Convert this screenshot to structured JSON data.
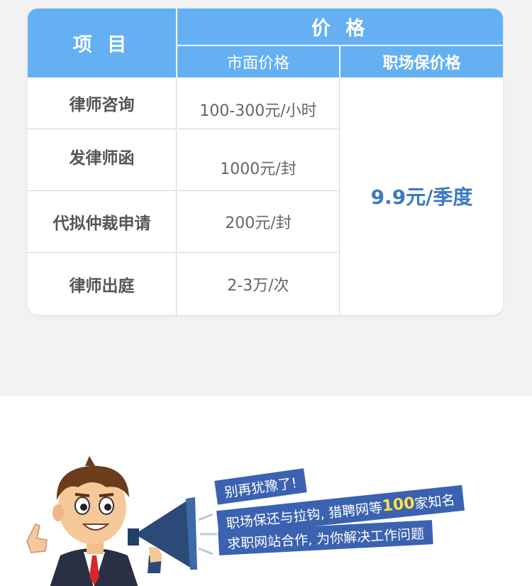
{
  "table": {
    "header": {
      "item": "项 目",
      "price": "价 格",
      "market": "市面价格",
      "ours": "职场保价格"
    },
    "rows": [
      {
        "name": "律师咨询",
        "market": "100-300元/小时"
      },
      {
        "name": "发律师函",
        "market": "1000元/封"
      },
      {
        "name": "代拟仲裁申请",
        "market": "200元/封"
      },
      {
        "name": "律师出庭",
        "market": "2-3万/次"
      }
    ],
    "ours_price": "9.9元/季度"
  },
  "banner": {
    "line1": "别再犹豫了!",
    "line2_pre": "职场保还与拉钩, 猎聘网等",
    "line2_num": "100",
    "line2_post": "家知名",
    "line3": "求职网站合作, 为你解决工作问题"
  },
  "colors": {
    "header_bg": "#64b0f2",
    "price_accent": "#3d78c4",
    "tag_bg": "#3b62b0",
    "highlight": "#ffe23b"
  }
}
